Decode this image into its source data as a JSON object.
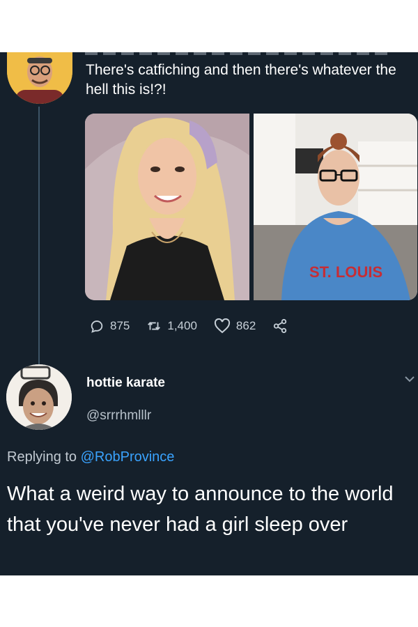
{
  "tweet": {
    "text": "There's catfiching and then there's whatever the hell this is!?!",
    "stats": {
      "replies": "875",
      "retweets": "1,400",
      "likes": "862"
    },
    "media": [
      {
        "label": "woman-blonde-photo"
      },
      {
        "label": "woman-glasses-hoodie-photo",
        "hoodie_text": "ST. LOUIS"
      }
    ]
  },
  "reply": {
    "name": "hottie karate",
    "handle": "@srrrhmlllr",
    "replying_label": "Replying to",
    "replying_mention": "@RobProvince",
    "text": "What a weird way to announce to the world that you've never had a girl sleep over"
  },
  "colors": {
    "background": "#15202b",
    "link": "#3aa3ff",
    "text": "#ffffff",
    "muted": "#c7d0d8"
  },
  "icons": [
    "reply-icon",
    "retweet-icon",
    "like-icon",
    "share-icon",
    "chevron-down-icon"
  ]
}
